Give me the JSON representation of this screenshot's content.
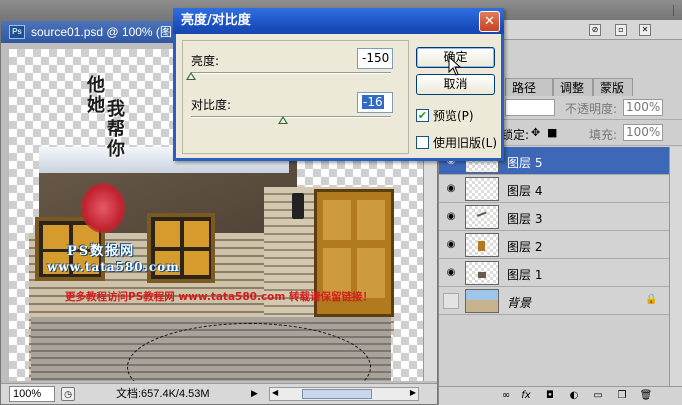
{
  "document": {
    "title": "source01.psd @ 100% (图",
    "app_icon": "Ps",
    "zoom": "100%",
    "doc_info": "文档:657.4K/4.53M"
  },
  "watermark": {
    "vertical_left": "他她",
    "vertical_right": "我帮你",
    "seal": "",
    "ps_line": "PS数报网",
    "url_line": "www.tata580.com",
    "red_line": "更多教程访问PS教程网 www.tata580.com 转载请保留链接！"
  },
  "panel": {
    "tabs": [
      "路径",
      "调整",
      "蒙版"
    ],
    "opacity_label": "不透明度:",
    "opacity_value": "100%",
    "lock_label": "锁定:",
    "fill_label": "填充:",
    "fill_value": "100%",
    "layers": [
      {
        "name": "图层 5",
        "visible": true,
        "selected": true
      },
      {
        "name": "图层 4",
        "visible": true,
        "selected": false
      },
      {
        "name": "图层 3",
        "visible": true,
        "selected": false
      },
      {
        "name": "图层 2",
        "visible": true,
        "selected": false
      },
      {
        "name": "图层 1",
        "visible": true,
        "selected": false
      },
      {
        "name": "背景",
        "visible": false,
        "selected": false
      }
    ],
    "bottom_icons": [
      "link-icon",
      "fx-icon",
      "mask-icon",
      "adjustment-icon",
      "group-icon",
      "new-layer-icon",
      "trash-icon"
    ]
  },
  "dialog": {
    "title": "亮度/对比度",
    "brightness_label": "亮度:",
    "brightness_value": "-150",
    "brightness_fraction": 0.0,
    "contrast_label": "对比度:",
    "contrast_value": "-16",
    "contrast_fraction": 0.46,
    "ok_label": "确定",
    "cancel_label": "取消",
    "preview_label": "预览(P)",
    "preview_checked": true,
    "legacy_label": "使用旧版(L)",
    "legacy_checked": false
  },
  "colors": {
    "title_blue": "#2f6fe0",
    "selected_layer": "#3d68b8",
    "watermark_red": "#d11d1d"
  }
}
